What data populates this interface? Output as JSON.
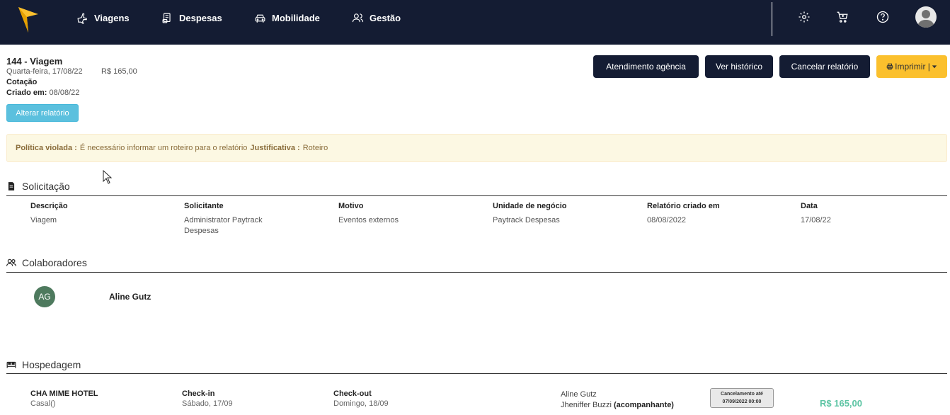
{
  "nav": {
    "items": [
      {
        "label": "Viagens",
        "icon": "plane-icon"
      },
      {
        "label": "Despesas",
        "icon": "receipt-icon"
      },
      {
        "label": "Mobilidade",
        "icon": "car-icon"
      },
      {
        "label": "Gestão",
        "icon": "users-icon"
      }
    ],
    "right_icons": [
      "gear-icon",
      "cart-icon",
      "help-icon",
      "user-avatar-icon"
    ]
  },
  "report": {
    "title": "144 - Viagem",
    "date": "Quarta-feira, 17/08/22",
    "amount": "R$ 165,00",
    "status": "Cotação",
    "created_label": "Criado em:",
    "created_value": "08/08/22",
    "alter_button": "Alterar relatório"
  },
  "actions": {
    "agency": "Atendimento agência",
    "history": "Ver histórico",
    "cancel": "Cancelar relatório",
    "print": "Imprimir |"
  },
  "alert": {
    "policy_label": "Política violada :",
    "policy_text": "É necessário informar um roteiro para o relatório",
    "justification_label": "Justificativa :",
    "justification_text": "Roteiro"
  },
  "solicitacao": {
    "title": "Solicitação",
    "columns": [
      {
        "header": "Descrição",
        "value": "Viagem"
      },
      {
        "header": "Solicitante",
        "value": "Administrator Paytrack Despesas"
      },
      {
        "header": "Motivo",
        "value": "Eventos externos"
      },
      {
        "header": "Unidade de negócio",
        "value": "Paytrack Despesas"
      },
      {
        "header": "Relatório criado em",
        "value": "08/08/2022"
      },
      {
        "header": "Data",
        "value": "17/08/22"
      }
    ]
  },
  "colaboradores": {
    "title": "Colaboradores",
    "items": [
      {
        "initials": "AG",
        "name": "Aline Gutz"
      }
    ]
  },
  "hospedagem": {
    "title": "Hospedagem",
    "hotel_name": "CHA MIME HOTEL",
    "room": "Casal()",
    "checkin_label": "Check-in",
    "checkin_value": "Sábado, 17/09",
    "checkout_label": "Check-out",
    "checkout_value": "Domingo, 18/09",
    "guest_1": "Aline Gutz",
    "guest_2": "Jheniffer Buzzi",
    "guest_2_role": "(acompanhante)",
    "cancel_label": "Cancelamento até",
    "cancel_date": "07/09/2022 00:00",
    "price": "R$ 165,00"
  },
  "colors": {
    "nav_bg": "#141c33",
    "accent_yellow": "#fbc02d",
    "info_blue": "#5bc0de",
    "price_green": "#5cc4a3",
    "avatar_green": "#4e7a5e"
  }
}
